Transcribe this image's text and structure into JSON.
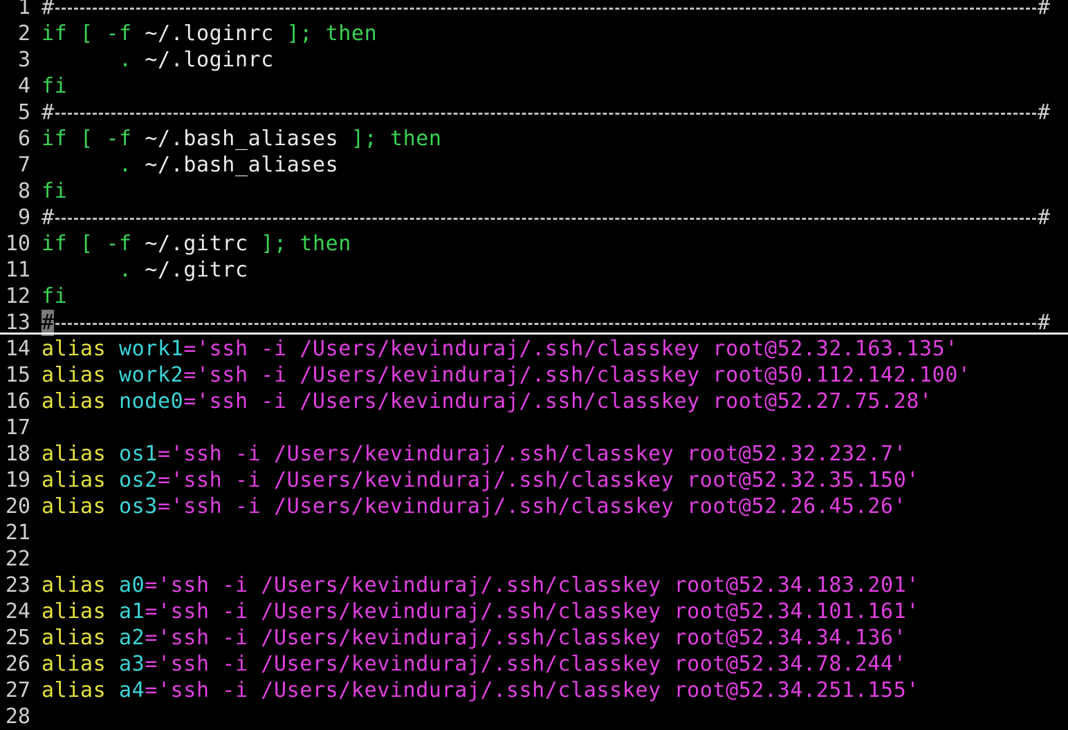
{
  "editor": {
    "lines": [
      {
        "num": "1",
        "type": "sep"
      },
      {
        "num": "2",
        "type": "if",
        "kw1": "if",
        "br_open": "[ -f",
        "path": " ~/.loginrc ",
        "br_close": "];",
        "kw2": "then"
      },
      {
        "num": "3",
        "type": "source",
        "dot": ".",
        "path": "~/.loginrc"
      },
      {
        "num": "4",
        "type": "fi",
        "kw": "fi"
      },
      {
        "num": "5",
        "type": "sep"
      },
      {
        "num": "6",
        "type": "if",
        "kw1": "if",
        "br_open": "[ -f",
        "path": " ~/.bash_aliases ",
        "br_close": "];",
        "kw2": "then"
      },
      {
        "num": "7",
        "type": "source",
        "dot": ".",
        "path": "~/.bash_aliases"
      },
      {
        "num": "8",
        "type": "fi",
        "kw": "fi"
      },
      {
        "num": "9",
        "type": "sep"
      },
      {
        "num": "10",
        "type": "if",
        "kw1": "if",
        "br_open": "[ -f",
        "path": " ~/.gitrc ",
        "br_close": "];",
        "kw2": "then"
      },
      {
        "num": "11",
        "type": "source",
        "dot": ".",
        "path": "~/.gitrc"
      },
      {
        "num": "12",
        "type": "fi",
        "kw": "fi"
      },
      {
        "num": "13",
        "type": "sep",
        "cursor": true
      },
      {
        "num": "14",
        "type": "alias",
        "kw": "alias",
        "name": "work1",
        "eq": "=",
        "value": "'ssh -i /Users/kevinduraj/.ssh/classkey root@52.32.163.135'"
      },
      {
        "num": "15",
        "type": "alias",
        "kw": "alias",
        "name": "work2",
        "eq": "=",
        "value": "'ssh -i /Users/kevinduraj/.ssh/classkey root@50.112.142.100'"
      },
      {
        "num": "16",
        "type": "alias",
        "kw": "alias",
        "name": "node0",
        "eq": "=",
        "value": "'ssh -i /Users/kevinduraj/.ssh/classkey root@52.27.75.28'"
      },
      {
        "num": "17",
        "type": "empty"
      },
      {
        "num": "18",
        "type": "alias",
        "kw": "alias",
        "name": "os1",
        "eq": "=",
        "value": "'ssh -i /Users/kevinduraj/.ssh/classkey root@52.32.232.7'"
      },
      {
        "num": "19",
        "type": "alias",
        "kw": "alias",
        "name": "os2",
        "eq": "=",
        "value": "'ssh -i /Users/kevinduraj/.ssh/classkey root@52.32.35.150'"
      },
      {
        "num": "20",
        "type": "alias",
        "kw": "alias",
        "name": "os3",
        "eq": "=",
        "value": "'ssh -i /Users/kevinduraj/.ssh/classkey root@52.26.45.26'"
      },
      {
        "num": "21",
        "type": "empty"
      },
      {
        "num": "22",
        "type": "empty"
      },
      {
        "num": "23",
        "type": "alias",
        "kw": "alias",
        "name": "a0",
        "eq": "=",
        "value": "'ssh -i /Users/kevinduraj/.ssh/classkey root@52.34.183.201'"
      },
      {
        "num": "24",
        "type": "alias",
        "kw": "alias",
        "name": "a1",
        "eq": "=",
        "value": "'ssh -i /Users/kevinduraj/.ssh/classkey root@52.34.101.161'"
      },
      {
        "num": "25",
        "type": "alias",
        "kw": "alias",
        "name": "a2",
        "eq": "=",
        "value": "'ssh -i /Users/kevinduraj/.ssh/classkey root@52.34.34.136'"
      },
      {
        "num": "26",
        "type": "alias",
        "kw": "alias",
        "name": "a3",
        "eq": "=",
        "value": "'ssh -i /Users/kevinduraj/.ssh/classkey root@52.34.78.244'"
      },
      {
        "num": "27",
        "type": "alias",
        "kw": "alias",
        "name": "a4",
        "eq": "=",
        "value": "'ssh -i /Users/kevinduraj/.ssh/classkey root@52.34.251.155'"
      },
      {
        "num": "28",
        "type": "empty"
      }
    ],
    "separator_char": "#"
  },
  "colors": {
    "background": "#000000",
    "keyword_green": "#39d353",
    "alias_yellow": "#e6e23c",
    "alias_name_cyan": "#3bd6d9",
    "string_magenta": "#e040e0",
    "text_white": "#ececec"
  }
}
